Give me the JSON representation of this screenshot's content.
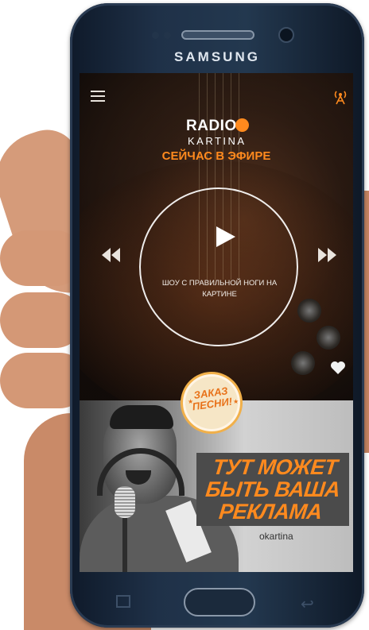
{
  "device": {
    "brand": "SAMSUNG"
  },
  "app": {
    "logo": {
      "top": "RADIO",
      "bottom": "KARTINA"
    },
    "now_playing_label": "СЕЙЧАС В ЭФИРЕ",
    "show_title": "ШОУ С ПРАВИЛЬНОЙ НОГИ НА КАРТИНЕ",
    "order_badge": "ЗАКАЗ ПЕСНИ!",
    "ad": {
      "text": "ТУТ МОЖЕТ БЫТЬ ВАША РЕКЛАМА",
      "site": "okartina"
    },
    "colors": {
      "accent": "#ff8a1e",
      "overlay_box": "#4b4b4b",
      "badge_bg": "#f6e6c6"
    },
    "icons": [
      "menu-icon",
      "antenna-icon",
      "play-icon",
      "rewind-icon",
      "fast-forward-icon",
      "heart-icon"
    ]
  }
}
